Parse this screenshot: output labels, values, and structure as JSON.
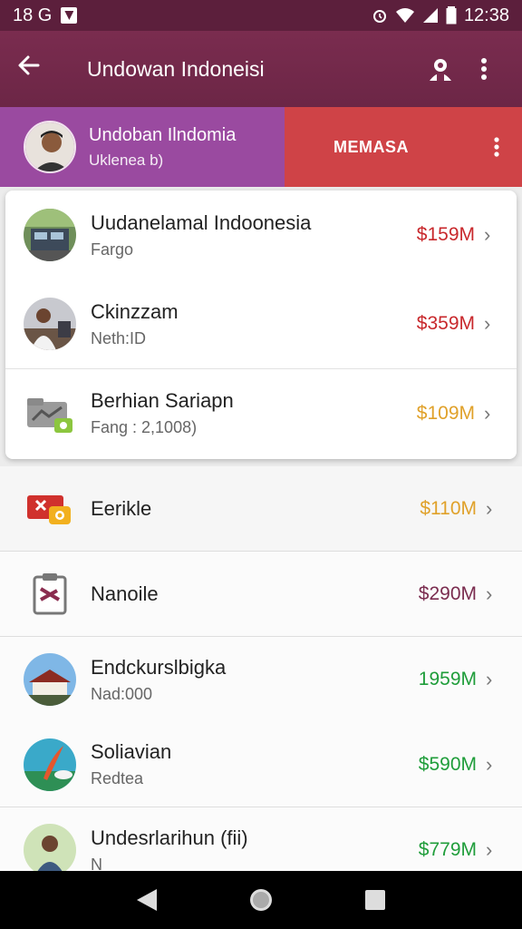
{
  "status_bar": {
    "left_text": "18 G",
    "time": "12:38"
  },
  "app_bar": {
    "title": "Undowan Indoneisi"
  },
  "account": {
    "name": "Undoban Ilndomia",
    "sub": "Uklenea b)",
    "action_label": "MEMASA"
  },
  "card_rows": [
    {
      "name": "Uudanelamal Indoonesia",
      "sub": "Fargo",
      "amount": "$159M",
      "amount_color": "#c8282c",
      "thumb": "photo-building"
    },
    {
      "name": "Ckinzzam",
      "sub": "Neth:ID",
      "amount": "$359M",
      "amount_color": "#c8282c",
      "thumb": "photo-person"
    },
    {
      "name": "Berhian Sariapn",
      "sub": "Fang : 2,1008)",
      "amount": "$109M",
      "amount_color": "#e0a12a",
      "thumb": "wallet-icon"
    }
  ],
  "list_rows": [
    {
      "name": "Eerikle",
      "sub": "",
      "amount": "$110M",
      "amount_color": "#e0a12a",
      "thumb": "card-icon"
    },
    {
      "name": "Nanoile",
      "sub": "",
      "amount": "$290M",
      "amount_color": "#7a2c4f",
      "thumb": "clipboard-icon"
    },
    {
      "name": "Endckurslbigka",
      "sub": "Nad:000",
      "amount": "1959M",
      "amount_color": "#1f9d3a",
      "thumb": "photo-house"
    },
    {
      "name": "Soliavian",
      "sub": "Redtea",
      "amount": "$590M",
      "amount_color": "#1f9d3a",
      "thumb": "photo-feather"
    },
    {
      "name": "Undesrlarihun (fii)",
      "sub": "N",
      "amount": "$779M",
      "amount_color": "#1f9d3a",
      "thumb": "photo-person"
    }
  ],
  "colors": {
    "status": "#5c1f3c",
    "appbar": "#7a2c4f",
    "account_left": "#9a4aa0",
    "account_right": "#cf4347"
  }
}
